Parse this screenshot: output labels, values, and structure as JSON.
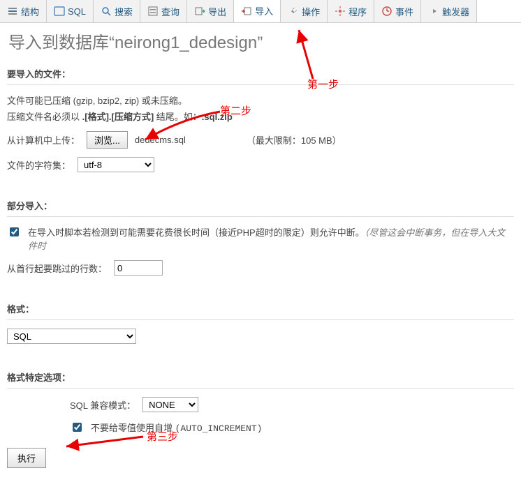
{
  "tabs": [
    {
      "label": "结构",
      "icon": "structure"
    },
    {
      "label": "SQL",
      "icon": "sql"
    },
    {
      "label": "搜索",
      "icon": "search"
    },
    {
      "label": "查询",
      "icon": "query"
    },
    {
      "label": "导出",
      "icon": "export"
    },
    {
      "label": "导入",
      "icon": "import",
      "active": true
    },
    {
      "label": "操作",
      "icon": "wrench"
    },
    {
      "label": "程序",
      "icon": "routines"
    },
    {
      "label": "事件",
      "icon": "clock"
    },
    {
      "label": "触发器",
      "icon": "trigger"
    }
  ],
  "page": {
    "title_prefix": "导入到数据库",
    "db_name": "neirong1_dedesign"
  },
  "file_section": {
    "heading": "要导入的文件：",
    "compress_note": "文件可能已压缩 (gzip, bzip2, zip) 或未压缩。",
    "name_rule_prefix": "压缩文件名必须以 ",
    "name_rule_bold1": ".[格式].[压缩方式]",
    "name_rule_mid": " 结尾。如：",
    "name_rule_bold2": ".sql.zip",
    "upload_label": "从计算机中上传：",
    "browse_btn": "浏览...",
    "file_name": "dedecms.sql",
    "max_limit": "（最大限制：105 MB）",
    "charset_label": "文件的字符集：",
    "charset_value": "utf-8"
  },
  "partial_section": {
    "heading": "部分导入：",
    "checkbox_text_a": "在导入时脚本若检测到可能需要花费很长时间（接近PHP超时的限定）则允许中断。",
    "checkbox_text_b": "（尽管这会中断事务，但在导入大文件时",
    "skip_label": "从首行起要跳过的行数：",
    "skip_value": "0"
  },
  "format_section": {
    "heading": "格式：",
    "format_value": "SQL"
  },
  "options_section": {
    "heading": "格式特定选项：",
    "compat_label": "SQL 兼容模式：",
    "compat_value": "NONE",
    "noautoinc_text": "不要给零值使用自增 ",
    "noautoinc_code": "(AUTO_INCREMENT)"
  },
  "footer": {
    "go_btn": "执行"
  },
  "annotations": {
    "step1": "第一步",
    "step2": "第二步",
    "step3": "第三步"
  }
}
